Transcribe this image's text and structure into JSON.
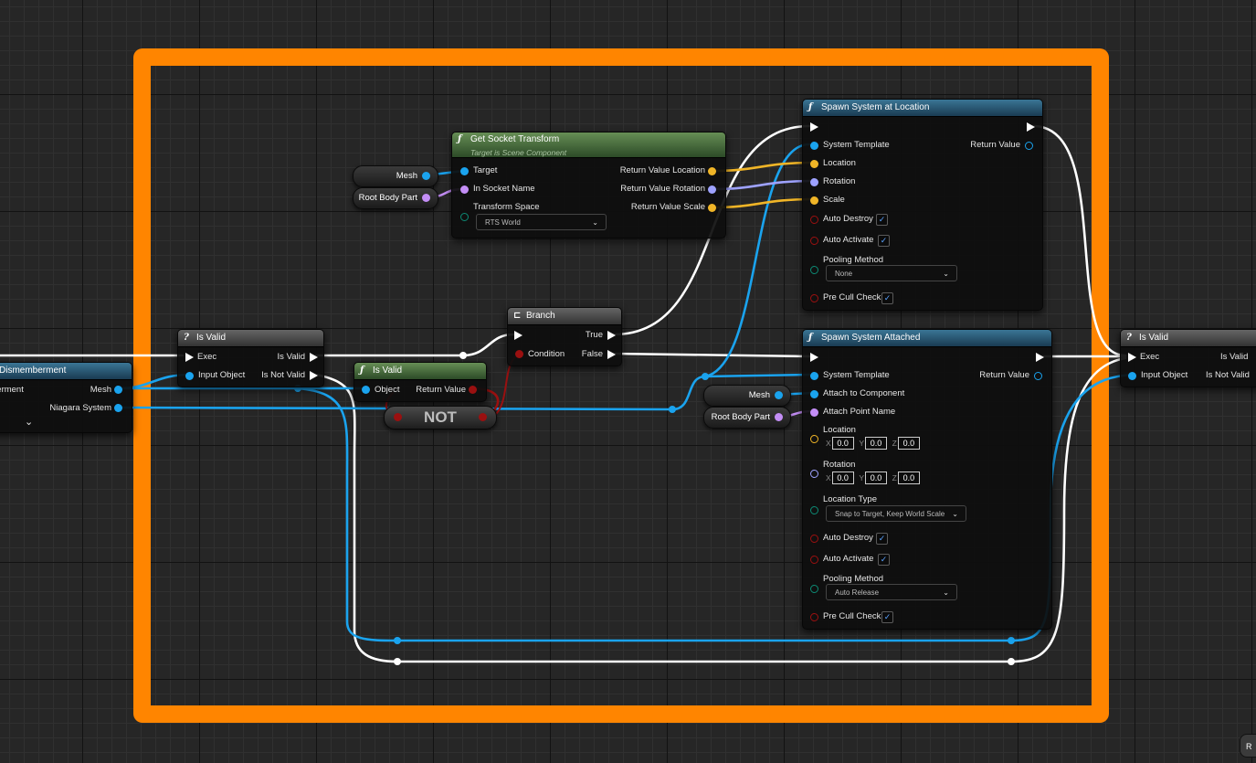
{
  "colors": {
    "comment_frame": "#ff8500",
    "exec_wire": "#ffffff",
    "object_pin": "#1aa3ee",
    "vector_pin": "#f0b527",
    "rotator_pin": "#9ea2ff",
    "name_pin": "#c48ef6",
    "bool_pin": "#960202",
    "enum_pin": "#0d6e5e"
  },
  "dismemberment": {
    "title": "Dismemberment",
    "mesh": "Mesh",
    "niagara": "Niagara System"
  },
  "isvalid1": {
    "title": "Is Valid",
    "exec": "Exec",
    "is_valid": "Is Valid",
    "input_object": "Input Object",
    "is_not_valid": "Is Not Valid"
  },
  "isvalid2": {
    "title": "Is Valid",
    "object": "Object",
    "return_value": "Return Value"
  },
  "not_node": {
    "label": "NOT"
  },
  "branch": {
    "title": "Branch",
    "true": "True",
    "condition": "Condition",
    "false": "False"
  },
  "socket": {
    "title": "Get Socket Transform",
    "subtitle": "Target is Scene Component",
    "target": "Target",
    "in_socket": "In Socket Name",
    "transform_space": "Transform Space",
    "transform_value": "RTS World",
    "rv_location": "Return Value Location",
    "rv_rotation": "Return Value Rotation",
    "rv_scale": "Return Value Scale"
  },
  "var_mesh1": "Mesh",
  "var_rootpart1": "Root Body Part",
  "var_mesh2": "Mesh",
  "var_rootpart2": "Root Body Part",
  "spawn_loc": {
    "title": "Spawn System at Location",
    "return_value": "Return Value",
    "system_template": "System Template",
    "location": "Location",
    "rotation": "Rotation",
    "scale": "Scale",
    "auto_destroy": "Auto Destroy",
    "auto_activate": "Auto Activate",
    "pooling": "Pooling Method",
    "pooling_value": "None",
    "pre_cull": "Pre Cull Check",
    "auto_destroy_checked": true,
    "auto_activate_checked": true,
    "pre_cull_checked": true
  },
  "spawn_att": {
    "title": "Spawn System Attached",
    "return_value": "Return Value",
    "system_template": "System Template",
    "attach_to": "Attach to Component",
    "attach_point": "Attach Point Name",
    "location": "Location",
    "loc_x": "0.0",
    "loc_y": "0.0",
    "loc_z": "0.0",
    "rotation": "Rotation",
    "rot_x": "0.0",
    "rot_y": "0.0",
    "rot_z": "0.0",
    "axis_x": "X",
    "axis_y": "Y",
    "axis_z": "Z",
    "location_type": "Location Type",
    "location_type_value": "Snap to Target, Keep World Scale",
    "auto_destroy": "Auto Destroy",
    "auto_activate": "Auto Activate",
    "pooling": "Pooling Method",
    "pooling_value": "Auto Release",
    "pre_cull": "Pre Cull Check",
    "auto_destroy_checked": true,
    "auto_activate_checked": true,
    "pre_cull_checked": true
  },
  "isvalid3": {
    "title": "Is Valid",
    "exec": "Exec",
    "is_valid": "Is Valid",
    "input_object": "Input Object",
    "is_not_valid": "Is Not Valid"
  },
  "corner_node": {
    "label": "R"
  },
  "check_glyph": "✓",
  "chevron_glyph": "⌄",
  "function_glyph": "ƒ",
  "question_glyph": "?",
  "branch_glyph": "⊏"
}
